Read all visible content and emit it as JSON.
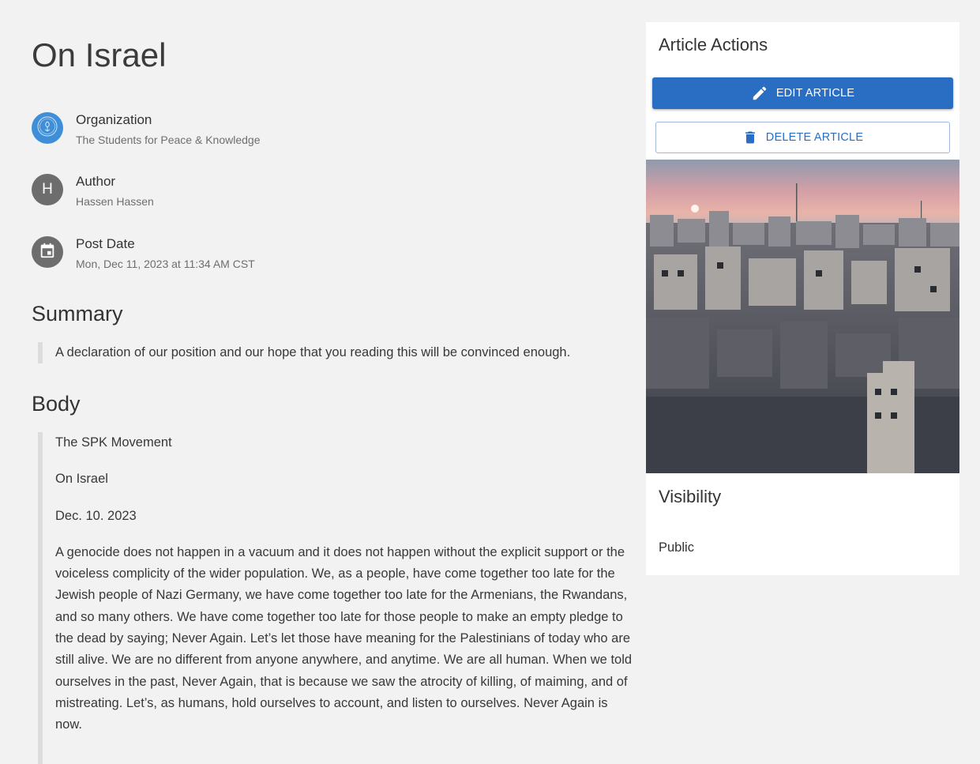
{
  "article": {
    "title": "On Israel",
    "organization_label": "Organization",
    "organization_value": "The Students for Peace & Knowledge",
    "author_label": "Author",
    "author_initial": "H",
    "author_value": "Hassen Hassen",
    "postdate_label": "Post Date",
    "postdate_value": "Mon, Dec 11, 2023 at 11:34 AM CST",
    "summary_heading": "Summary",
    "summary_text": "A declaration of our position and our hope that you reading this will be convinced enough.",
    "body_heading": "Body",
    "body_paragraphs": [
      "The SPK Movement",
      "On Israel",
      "Dec. 10. 2023",
      "A genocide does not happen in a vacuum and it does not happen without the explicit support or the voiceless complicity of the wider population. We, as a people, have come together too late for the Jewish people of Nazi Germany, we have come together too late for the Armenians, the Rwandans, and so many others. We have come together too late for those people to make an empty pledge to the dead by saying; Never Again. Let’s let those have meaning for the Palestinians of today who are still alive. We are no different from anyone anywhere, and anytime. We are all human. When we told ourselves in the past, Never Again, that is because we saw the atrocity of killing, of maiming, and of mistreating. Let’s, as humans, hold ourselves to account, and listen to ourselves. Never Again is now."
    ]
  },
  "sidebar": {
    "actions_title": "Article Actions",
    "edit_label": "EDIT ARTICLE",
    "delete_label": "DELETE ARTICLE",
    "visibility_title": "Visibility",
    "visibility_value": "Public"
  },
  "icons": {
    "organization": "organization-logo-icon",
    "calendar": "calendar-icon",
    "edit": "pencil-icon",
    "delete": "trash-icon"
  },
  "colors": {
    "primary": "#2a6ec3",
    "org_avatar": "#3f8fd8",
    "avatar_gray": "#6d6d6d",
    "background": "#f2f2f2"
  }
}
